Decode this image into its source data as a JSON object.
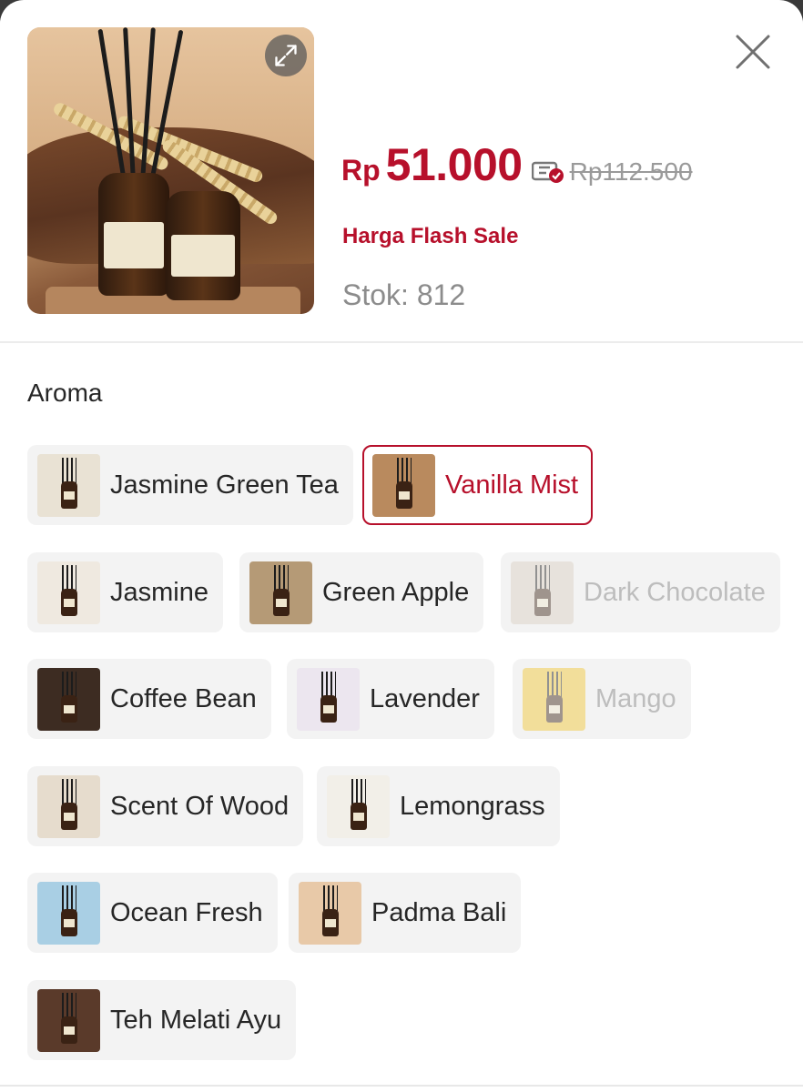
{
  "product": {
    "price_currency": "Rp",
    "price_value": "51.000",
    "price_original": "Rp112.500",
    "flash_label": "Harga Flash Sale",
    "stock_label": "Stok: 812"
  },
  "aroma": {
    "title": "Aroma",
    "options": [
      {
        "label": "Jasmine Green Tea",
        "state": "default",
        "thumb_color": "#e9e2d4"
      },
      {
        "label": "Vanilla Mist",
        "state": "selected",
        "thumb_color": "#b98a5e"
      },
      {
        "label": "Jasmine",
        "state": "default",
        "thumb_color": "#efe9e0"
      },
      {
        "label": "Green Apple",
        "state": "default",
        "thumb_color": "#b59a76"
      },
      {
        "label": "Dark Chocolate",
        "state": "disabled",
        "thumb_color": "#d9cfc2"
      },
      {
        "label": "Coffee Bean",
        "state": "default",
        "thumb_color": "#3d2c22"
      },
      {
        "label": "Lavender",
        "state": "default",
        "thumb_color": "#ece6ef"
      },
      {
        "label": "Mango",
        "state": "disabled",
        "thumb_color": "#f2c630"
      },
      {
        "label": "Scent Of Wood",
        "state": "default",
        "thumb_color": "#e6dccd"
      },
      {
        "label": "Lemongrass",
        "state": "default",
        "thumb_color": "#f2efe8"
      },
      {
        "label": "Ocean Fresh",
        "state": "default",
        "thumb_color": "#a9cfe4"
      },
      {
        "label": "Padma Bali",
        "state": "default",
        "thumb_color": "#e8c9a8"
      },
      {
        "label": "Teh Melati Ayu",
        "state": "default",
        "thumb_color": "#5a3a2a"
      }
    ]
  },
  "colors": {
    "accent": "#b7102b",
    "muted": "#8c8c8c",
    "chip_bg": "#f3f3f3"
  },
  "icons": {
    "expand": "expand-icon",
    "close": "close-icon",
    "voucher": "voucher-icon"
  }
}
